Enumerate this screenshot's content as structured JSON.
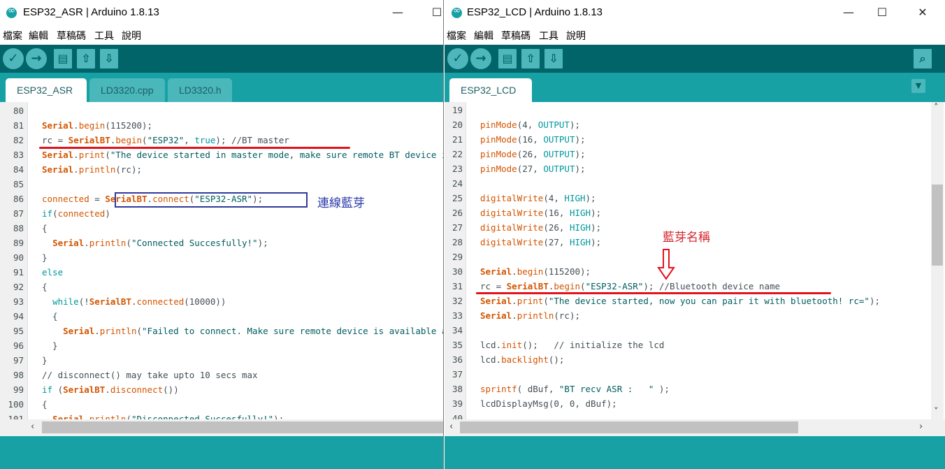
{
  "left_window": {
    "title": "ESP32_ASR | Arduino 1.8.13",
    "menu": [
      "檔案",
      "編輯",
      "草稿碼",
      "工具",
      "說明"
    ],
    "tabs": [
      "ESP32_ASR",
      "LD3320.cpp",
      "LD3320.h"
    ],
    "active_tab": "ESP32_ASR",
    "line_numbers": [
      "80",
      "81",
      "82",
      "83",
      "84",
      "85",
      "86",
      "87",
      "88",
      "89",
      "90",
      "91",
      "92",
      "93",
      "94",
      "95",
      "96",
      "97",
      "98",
      "99",
      "100",
      "101"
    ],
    "annotation_label": "連線藍芽"
  },
  "right_window": {
    "title": "ESP32_LCD | Arduino 1.8.13",
    "menu": [
      "檔案",
      "編輯",
      "草稿碼",
      "工具",
      "說明"
    ],
    "tabs": [
      "ESP32_LCD"
    ],
    "active_tab": "ESP32_LCD",
    "line_numbers": [
      "19",
      "20",
      "21",
      "22",
      "23",
      "24",
      "25",
      "26",
      "27",
      "28",
      "29",
      "30",
      "31",
      "32",
      "33",
      "34",
      "35",
      "36",
      "37",
      "38",
      "39",
      "40"
    ],
    "annotation_label": "藍芽名稱"
  },
  "icons": {
    "verify": "check-icon",
    "upload": "arrow-right-icon",
    "new": "new-file-icon",
    "open": "open-arrow-up-icon",
    "save": "save-arrow-down-icon",
    "serial_monitor": "magnifier-icon"
  },
  "colors": {
    "toolbar": "#006468",
    "tabbar": "#17a1a5",
    "annotation_red": "#e3121c",
    "annotation_blue": "#2f3a9c"
  }
}
